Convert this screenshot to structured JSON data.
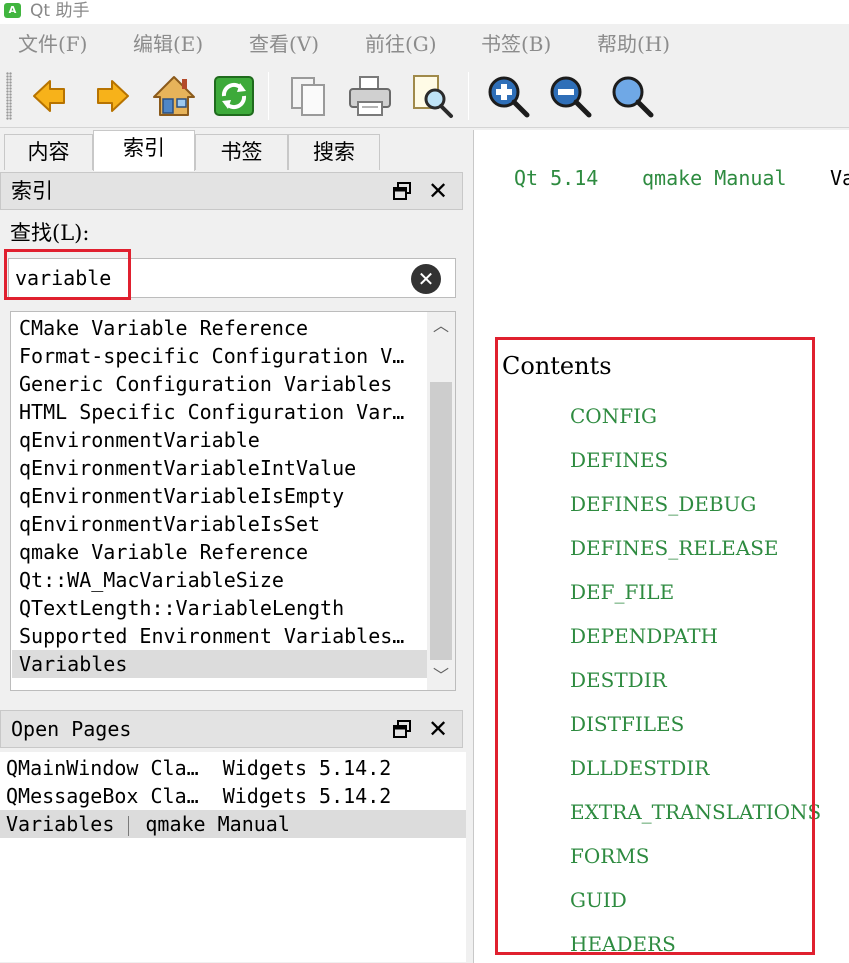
{
  "window": {
    "title": "Qt 助手",
    "icon_label": "A"
  },
  "menu": [
    "文件(F)",
    "编辑(E)",
    "查看(V)",
    "前往(G)",
    "书签(B)",
    "帮助(H)"
  ],
  "toolbar": {
    "buttons": [
      "back-icon",
      "forward-icon",
      "home-icon",
      "sync-icon",
      "copy-icon",
      "print-icon",
      "find-icon",
      "zoom-in-icon",
      "zoom-out-icon",
      "zoom-reset-icon"
    ]
  },
  "tabs": [
    "内容",
    "索引",
    "书签",
    "搜索"
  ],
  "active_tab": "索引",
  "index_dock": {
    "title": "索引",
    "find_label": "查找(L):",
    "search_value": "variable",
    "items": [
      "CMake Variable Reference",
      "Format-specific Configuration V…",
      "Generic Configuration Variables",
      "HTML Specific Configuration Var…",
      "qEnvironmentVariable",
      "qEnvironmentVariableIntValue",
      "qEnvironmentVariableIsEmpty",
      "qEnvironmentVariableIsSet",
      "qmake Variable Reference",
      "Qt::WA_MacVariableSize",
      "QTextLength::VariableLength",
      "Supported Environment Variables…",
      "Variables"
    ],
    "selected_item": "Variables"
  },
  "open_pages": {
    "title": "Open Pages",
    "rows": [
      {
        "page": "QMainWindow Cla…",
        "module": "Widgets 5.14.2"
      },
      {
        "page": "QMessageBox Cla…",
        "module": "Widgets 5.14.2"
      },
      {
        "page": "Variables",
        "module": "qmake Manual"
      }
    ],
    "selected_row": 2
  },
  "content": {
    "breadcrumbs": [
      "Qt 5.14",
      "qmake Manual",
      "Va"
    ],
    "contents_title": "Contents",
    "toc": [
      "CONFIG",
      "DEFINES",
      "DEFINES_DEBUG",
      "DEFINES_RELEASE",
      "DEF_FILE",
      "DEPENDPATH",
      "DESTDIR",
      "DISTFILES",
      "DLLDESTDIR",
      "EXTRA_TRANSLATIONS",
      "FORMS",
      "GUID",
      "HEADERS"
    ]
  },
  "colors": {
    "link": "#2e8b40",
    "highlight_box": "#e0202f",
    "selection": "#dcdcdc"
  }
}
